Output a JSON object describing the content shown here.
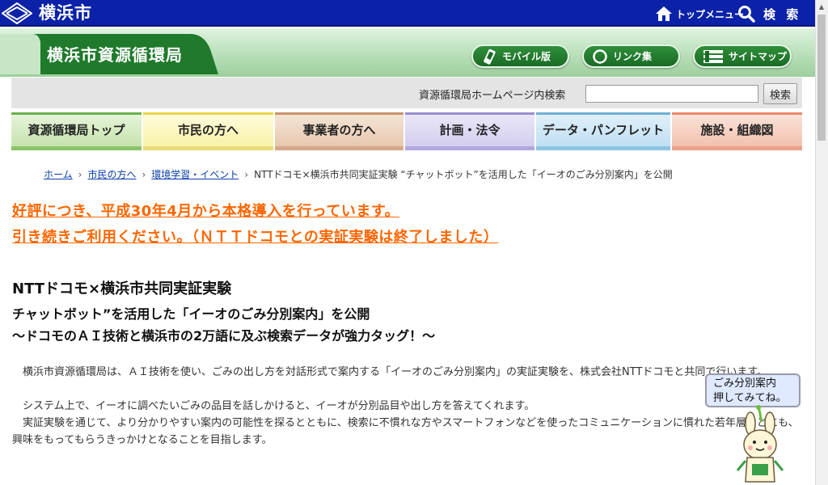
{
  "header": {
    "city_name": "横浜市",
    "top_menu_label": "トップメニュー",
    "search_label": "検 索"
  },
  "bureau": {
    "name": "横浜市資源循環局",
    "links": [
      {
        "label": "モバイル版",
        "icon": "mobile-phone-icon"
      },
      {
        "label": "リンク集",
        "icon": "circle-link-icon"
      },
      {
        "label": "サイトマップ",
        "icon": "sitemap-icon"
      }
    ]
  },
  "site_search": {
    "label": "資源循環局ホームページ内検索",
    "placeholder": "",
    "button_label": "検索"
  },
  "nav": {
    "tabs": [
      {
        "label": "資源循環局トップ",
        "color": "#6ab04c"
      },
      {
        "label": "市民の方へ",
        "color": "#e8d64a"
      },
      {
        "label": "事業者の方へ",
        "color": "#c9956a"
      },
      {
        "label": "計画・法令",
        "color": "#9a8fd0"
      },
      {
        "label": "データ・パンフレット",
        "color": "#6fb0d8"
      },
      {
        "label": "施設・組織図",
        "color": "#e8886a"
      }
    ]
  },
  "breadcrumb": {
    "items": [
      "ホーム",
      "市民の方へ",
      "環境学習・イベント"
    ],
    "current": "NTTドコモ×横浜市共同実証実験 “チャットボット”を活用した「イーオのごみ分別案内」を公開"
  },
  "notice": {
    "line1": "好評につき、平成30年4月から本格導入を行っています。",
    "line2": "引き続きご利用ください。（ＮＴＴドコモとの実証実験は終了しました）"
  },
  "article": {
    "title": "NTTドコモ×横浜市共同実証実験",
    "subtitle1": "チャットボット”を活用した「イーオのごみ分別案内」を公開",
    "subtitle2": "～ドコモのＡＩ技術と横浜市の2万語に及ぶ検索データが強力タッグ！～",
    "paragraphs": [
      "　横浜市資源循環局は、ＡＩ技術を使い、ごみの出し方を対話形式で案内する「イーオのごみ分別案内」の実証実験を、株式会社NTTドコモと共同で行います。",
      "　システム上で、イーオに調べたいごみの品目を話しかけると、イーオが分別品目や出し方を答えてくれます。",
      "　実証実験を通じて、より分かりやすい案内の可能性を探るとともに、検索に不慣れな方やスマートフォンなどを使ったコミュニケーションに慣れた若年層などにも、興味をもってもらうきっかけとなることを目指します。"
    ]
  },
  "mascot_bubble": {
    "line1": "ごみ分別案内",
    "line2": "押してみてね。"
  }
}
